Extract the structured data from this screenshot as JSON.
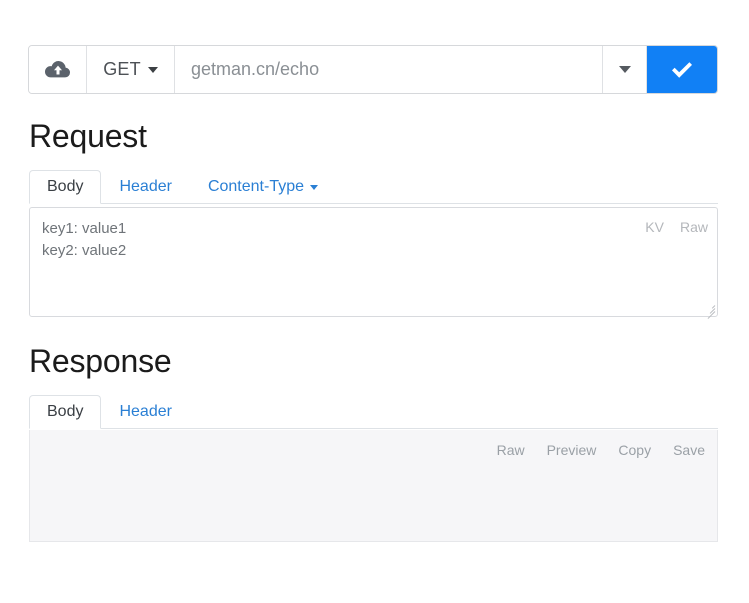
{
  "urlbar": {
    "upload_icon": "cloud-upload-icon",
    "method": "GET",
    "url_value": "getman.cn/echo",
    "history_icon": "chevron-down-icon",
    "send_icon": "check-icon"
  },
  "request": {
    "title": "Request",
    "tabs": [
      {
        "label": "Body",
        "active": true
      },
      {
        "label": "Header",
        "active": false
      },
      {
        "label": "Content-Type",
        "active": false,
        "dropdown": true
      }
    ],
    "body_placeholder": "key1: value1\nkey2: value2",
    "view_modes": [
      "KV",
      "Raw"
    ]
  },
  "response": {
    "title": "Response",
    "tabs": [
      {
        "label": "Body",
        "active": true
      },
      {
        "label": "Header",
        "active": false
      }
    ],
    "actions": [
      "Raw",
      "Preview",
      "Copy",
      "Save"
    ],
    "body_content": ""
  },
  "colors": {
    "accent_blue": "#1180f5",
    "link_blue": "#2a7fd4",
    "border": "#dee2e6",
    "panel_bg": "#f6f6f8",
    "muted_text": "#9aa0a6"
  }
}
